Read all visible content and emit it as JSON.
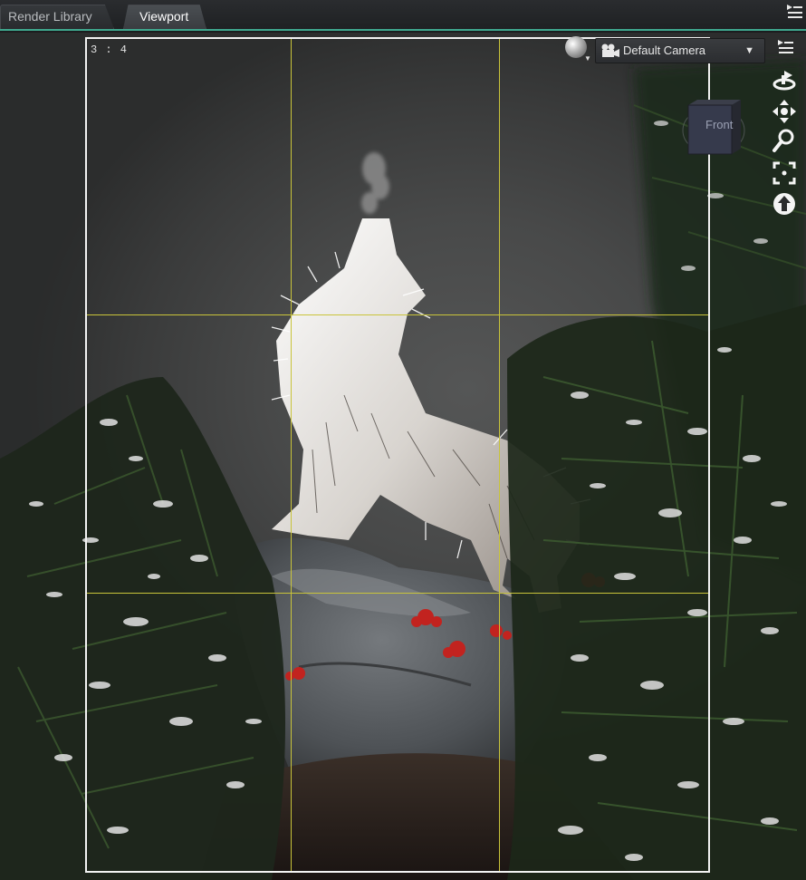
{
  "tabs": [
    {
      "label": "Render Library",
      "active": false
    },
    {
      "label": "Viewport",
      "active": true
    }
  ],
  "viewport": {
    "aspect_label": "3 : 4",
    "camera": {
      "selected": "Default Camera",
      "icon": "camera-icon"
    },
    "view_cube_label": "Front",
    "nav_tools": [
      "orbit-icon",
      "pan-icon",
      "zoom-icon",
      "frame-icon",
      "up-arrow-icon"
    ],
    "panel_menu_icon": "panel-menu-icon"
  },
  "colors": {
    "tab_accent": "#3fa88e",
    "frame_border": "#f2f2f2",
    "thirds_grid": "#c9c43a",
    "background": "#1b1d1f"
  }
}
